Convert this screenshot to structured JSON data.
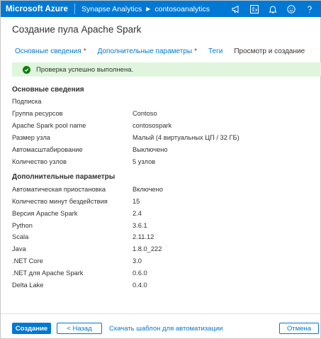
{
  "topbar": {
    "brand": "Microsoft Azure",
    "breadcrumb": [
      "Synapse Analytics",
      "contosoanalytics"
    ],
    "icons": [
      "megaphone-icon",
      "portal-switch-icon",
      "bell-icon",
      "smiley-icon",
      "help-icon"
    ],
    "color": "#0078d4"
  },
  "page": {
    "title": "Создание пула Apache Spark"
  },
  "tabs": [
    {
      "label": "Основные сведения",
      "required": "*"
    },
    {
      "label": "Дополнительные параметры",
      "required": "*"
    },
    {
      "label": "Теги",
      "required": ""
    },
    {
      "label": "Просмотр и создание",
      "required": ""
    }
  ],
  "banner": {
    "message": "Проверка успешно выполнена.",
    "color": "#dff6dd"
  },
  "basics": {
    "heading": "Основные сведения",
    "rows": [
      {
        "key": "Подписка",
        "value": ""
      },
      {
        "key": "Группа ресурсов",
        "value": "Contoso"
      },
      {
        "key": "Apache Spark pool name",
        "value": "contosospark"
      },
      {
        "key": "Размер узла",
        "value": "Малый (4 виртуальных ЦП / 32 ГБ)"
      },
      {
        "key": "Автомасштабирование",
        "value": "Выключено"
      },
      {
        "key": "Количество узлов",
        "value": "5 узлов"
      }
    ]
  },
  "advanced": {
    "heading": "Дополнительные параметры",
    "rows": [
      {
        "key": "Автоматическая приостановка",
        "value": "Включено"
      },
      {
        "key": "Количество минут бездействия",
        "value": "15"
      },
      {
        "key": "Версия Apache Spark",
        "value": "2.4"
      },
      {
        "key": "Python",
        "value": "3.6.1"
      },
      {
        "key": "Scala",
        "value": "2.11.12"
      },
      {
        "key": "Java",
        "value": "1.8.0_222"
      },
      {
        "key": ".NET Core",
        "value": "3.0"
      },
      {
        "key": ".NET для Apache Spark",
        "value": "0.6.0"
      },
      {
        "key": "Delta Lake",
        "value": "0.4.0"
      }
    ]
  },
  "footer": {
    "create_label": "Создание",
    "back_label": "< Назад",
    "template_link": "Скачать шаблон для автоматизации",
    "cancel_label": "Отмена"
  }
}
